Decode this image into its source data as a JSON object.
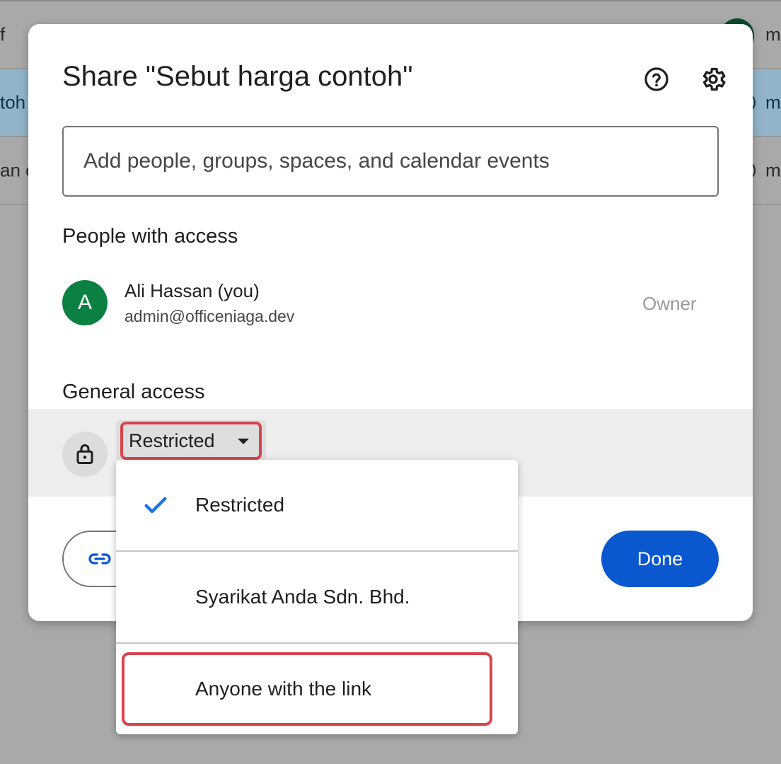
{
  "background_list": {
    "rows": [
      {
        "name": "f",
        "owner": "m",
        "selected": false
      },
      {
        "name": "toh",
        "owner": "m",
        "selected": true
      },
      {
        "name": "an c",
        "owner": "m",
        "selected": false
      }
    ]
  },
  "dialog": {
    "title": "Share \"Sebut harga contoh\"",
    "help_icon": "help-circle-icon",
    "settings_icon": "gear-icon",
    "search": {
      "placeholder": "Add people, groups, spaces, and calendar events",
      "value": ""
    },
    "people_section": {
      "title": "People with access",
      "people": [
        {
          "initial": "A",
          "name": "Ali Hassan (you)",
          "email": "admin@officeniaga.dev",
          "role": "Owner",
          "avatar_color": "#0b8043"
        }
      ]
    },
    "general_access": {
      "title": "General access",
      "icon": "lock-icon",
      "selected": "Restricted"
    },
    "copy_link_icon": "link-icon",
    "done_label": "Done"
  },
  "access_menu": {
    "items": [
      {
        "label": "Restricted",
        "checked": true
      },
      {
        "label": "Syarikat Anda Sdn. Bhd.",
        "checked": false
      },
      {
        "label": "Anyone with the link",
        "checked": false,
        "highlighted": true
      }
    ]
  },
  "colors": {
    "accent": "#0b57d0",
    "highlight": "#d6454f",
    "check": "#1a73e8"
  }
}
